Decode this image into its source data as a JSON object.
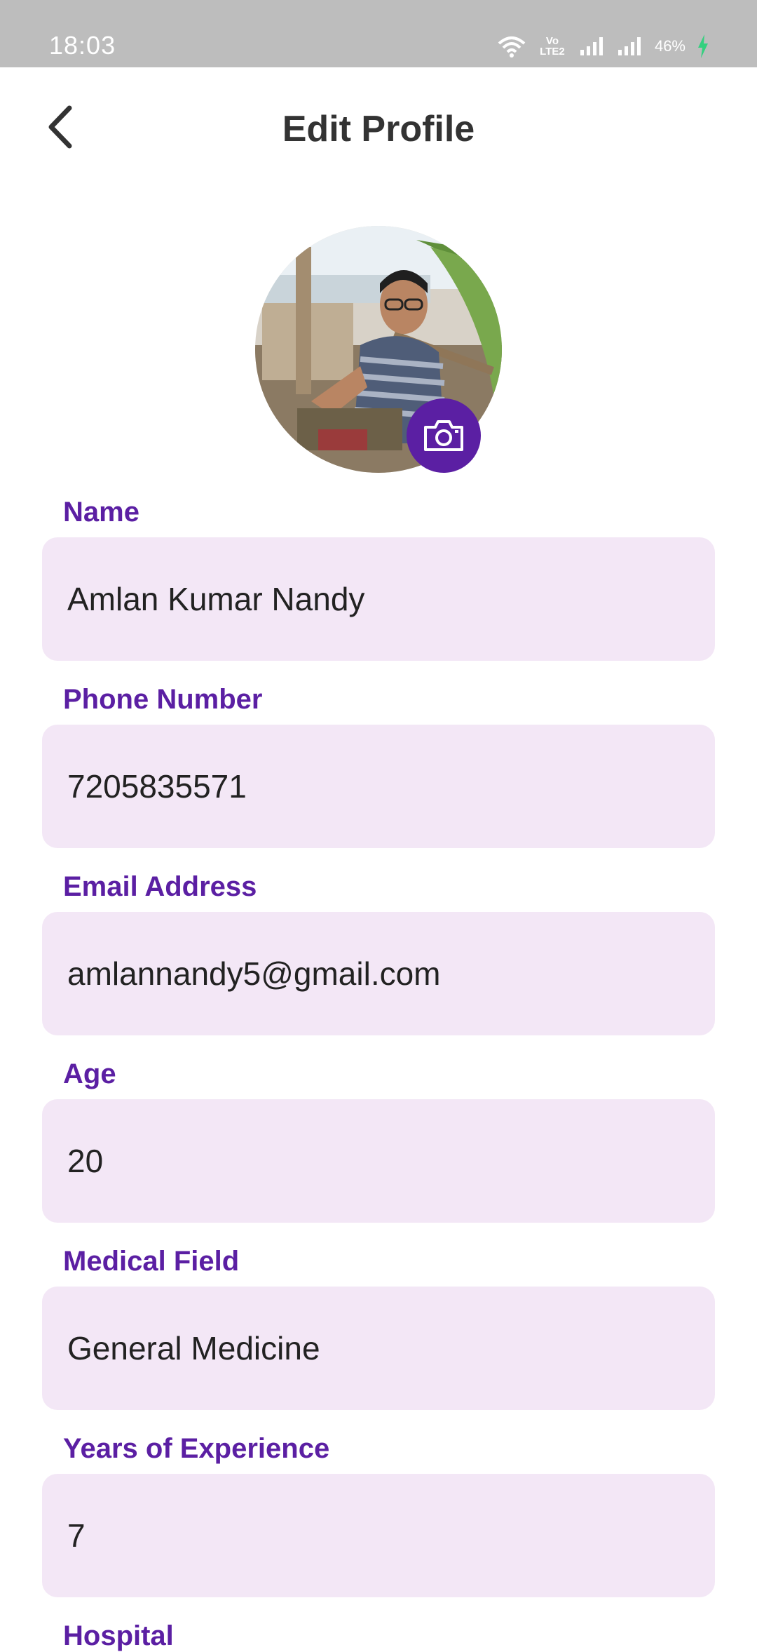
{
  "status_bar": {
    "time": "18:03",
    "battery": "46%",
    "volte_line1": "Vo",
    "volte_line2": "LTE2"
  },
  "header": {
    "title": "Edit Profile"
  },
  "profile": {
    "avatar_icon": "profile-photo",
    "camera_icon": "camera-icon"
  },
  "fields": [
    {
      "label": "Name",
      "value": "Amlan Kumar Nandy"
    },
    {
      "label": "Phone Number",
      "value": "7205835571"
    },
    {
      "label": "Email Address",
      "value": "amlannandy5@gmail.com"
    },
    {
      "label": "Age",
      "value": "20"
    },
    {
      "label": "Medical Field",
      "value": "General Medicine"
    },
    {
      "label": "Years of Experience",
      "value": "7"
    },
    {
      "label": "Hospital",
      "value": ""
    }
  ],
  "colors": {
    "accent": "#5b1fa3",
    "field_bg": "#f3e7f6",
    "status_bar": "#bdbdbd"
  }
}
